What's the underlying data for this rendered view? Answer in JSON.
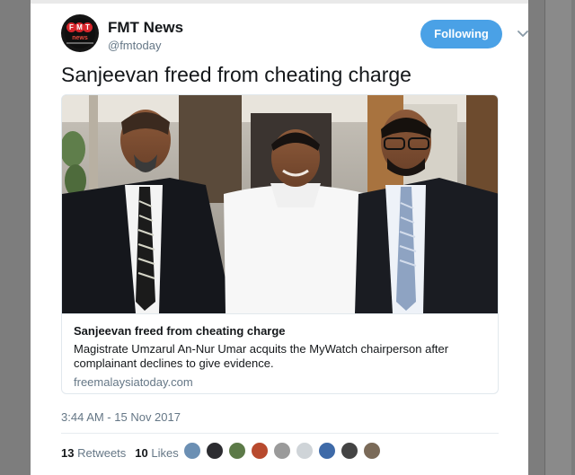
{
  "account": {
    "name": "FMT News",
    "handle": "@fmtoday",
    "avatar_letters": [
      "F",
      "M",
      "T"
    ],
    "avatar_sub": "news"
  },
  "follow_label": "Following",
  "tweet_text": "Sanjeevan freed from cheating charge",
  "card": {
    "title": "Sanjeevan freed from cheating charge",
    "description": "Magistrate Umzarul An-Nur Umar acquits the MyWatch chairperson after complainant declines to give evidence.",
    "domain": "freemalaysiatoday.com"
  },
  "timestamp": "3:44 AM - 15 Nov 2017",
  "stats": {
    "retweets_count": "13",
    "retweets_label": "Retweets",
    "likes_count": "10",
    "likes_label": "Likes"
  },
  "colors": {
    "accent": "#4aa1e6",
    "brand_red": "#d8262c",
    "text": "#14171a",
    "muted": "#657786"
  },
  "icons": [
    "chevron-down-icon"
  ]
}
